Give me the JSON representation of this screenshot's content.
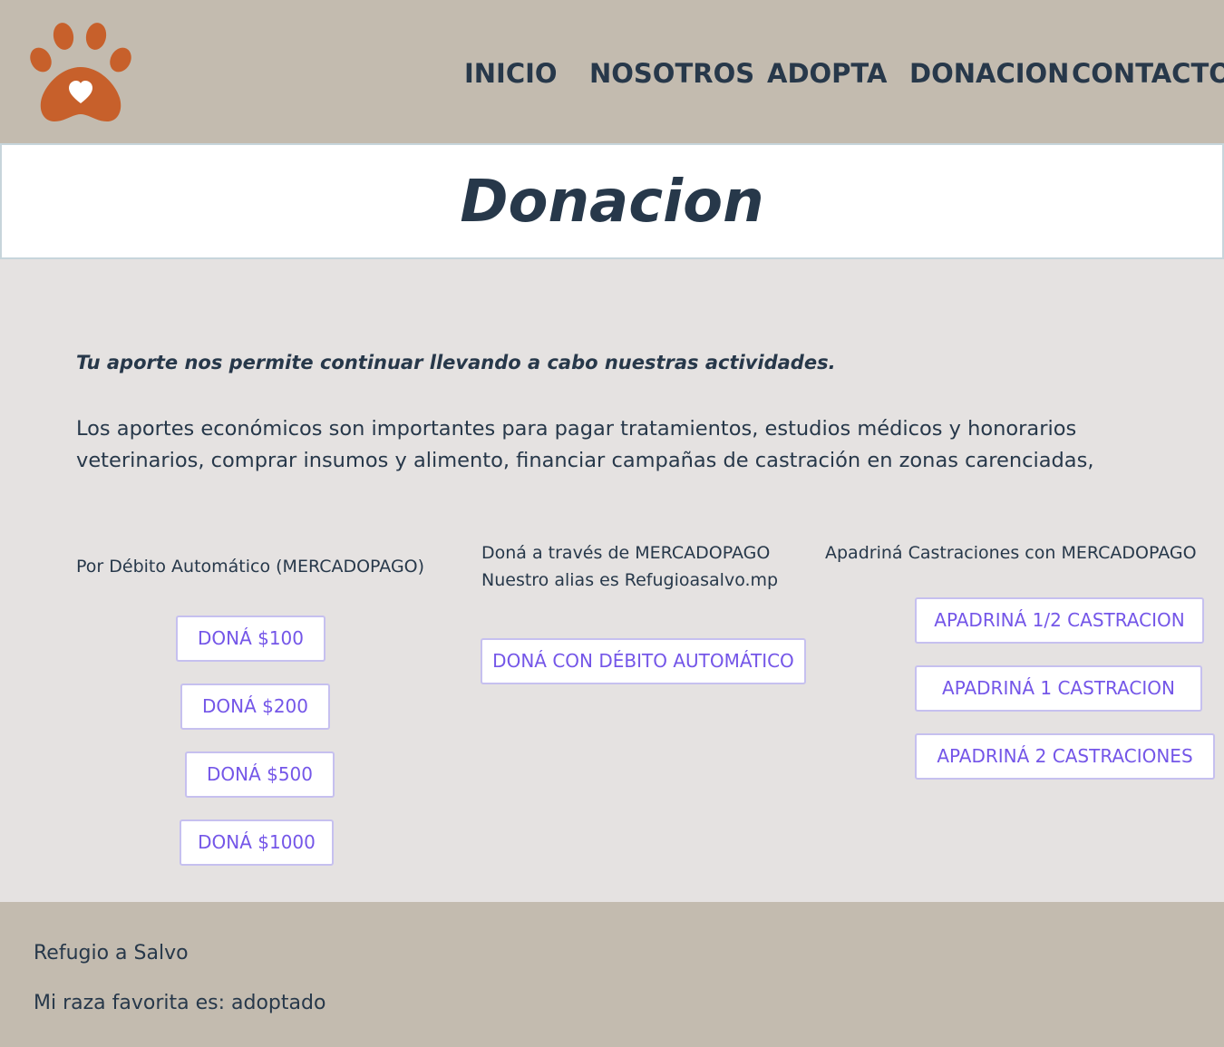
{
  "header": {
    "logo_icon": "paw-heart-icon",
    "logo_color": "#c7602b",
    "nav": [
      {
        "label": "INICIO"
      },
      {
        "label": "NOSOTROS"
      },
      {
        "label": "ADOPTA"
      },
      {
        "label": "DONACION"
      },
      {
        "label": "CONTACTO"
      }
    ]
  },
  "page_title": "Donacion",
  "intro": {
    "headline": "Tu aporte nos permite continuar llevando a cabo nuestras actividades.",
    "body_line1": "Los aportes económicos son importantes para pagar tratamientos, estudios médicos y honorarios",
    "body_line2": "veterinarios, comprar insumos y alimento, financiar campañas de castración en zonas carenciadas,"
  },
  "columns": {
    "debit": {
      "title": "Por Débito Automático (MERCADOPAGO)",
      "buttons": [
        "DONÁ $100",
        "DONÁ $200",
        "DONÁ $500",
        "DONÁ $1000"
      ]
    },
    "mercadopago": {
      "title_line1": "Doná a través de MERCADOPAGO",
      "title_line2": "Nuestro alias es Refugioasalvo.mp",
      "button": "DONÁ CON DÉBITO AUTOMÁTICO"
    },
    "castration": {
      "title": "Apadriná Castraciones con MERCADOPAGO",
      "buttons": [
        "APADRINÁ 1/2 CASTRACION",
        "APADRINÁ 1 CASTRACION",
        "APADRINÁ 2 CASTRACIONES"
      ]
    }
  },
  "footer": {
    "name": "Refugio a Salvo",
    "tagline": "Mi raza favorita es: adoptado"
  },
  "colors": {
    "header_bg": "#c3bbaf",
    "main_bg": "#e5e2e1",
    "text_dark": "#27384a",
    "button_text": "#7456e8",
    "button_border": "#c6c0ef"
  }
}
